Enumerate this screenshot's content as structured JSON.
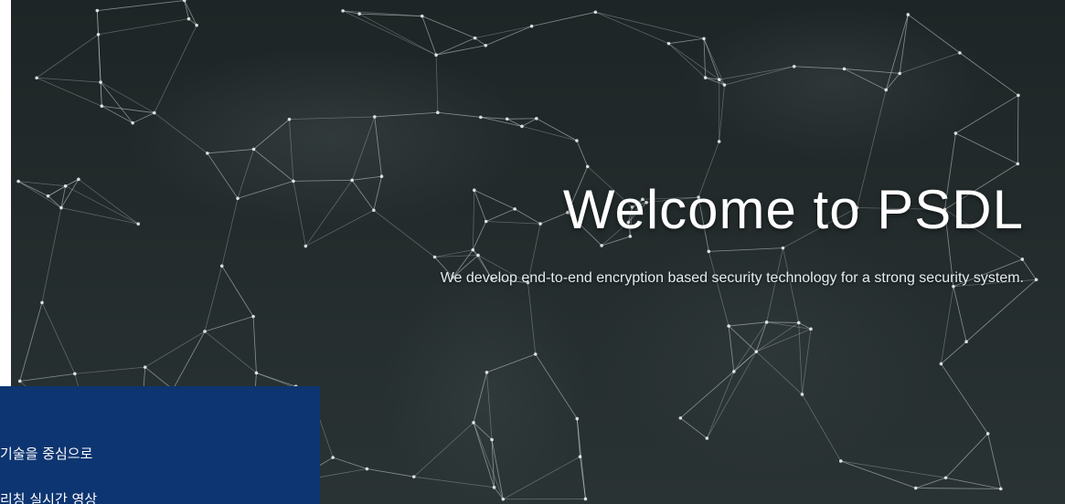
{
  "hero": {
    "title": "Welcome to PSDL",
    "subtitle": "We develop end-to-end encryption based security technology for a strong security system."
  },
  "overlay": {
    "lines": [
      "기술을 중심으로",
      "리칭 실시간 영상"
    ]
  },
  "colors": {
    "overlay_background": "#0d3571",
    "hero_background": "#232b2c",
    "network_lines": "#c8d2d6"
  }
}
